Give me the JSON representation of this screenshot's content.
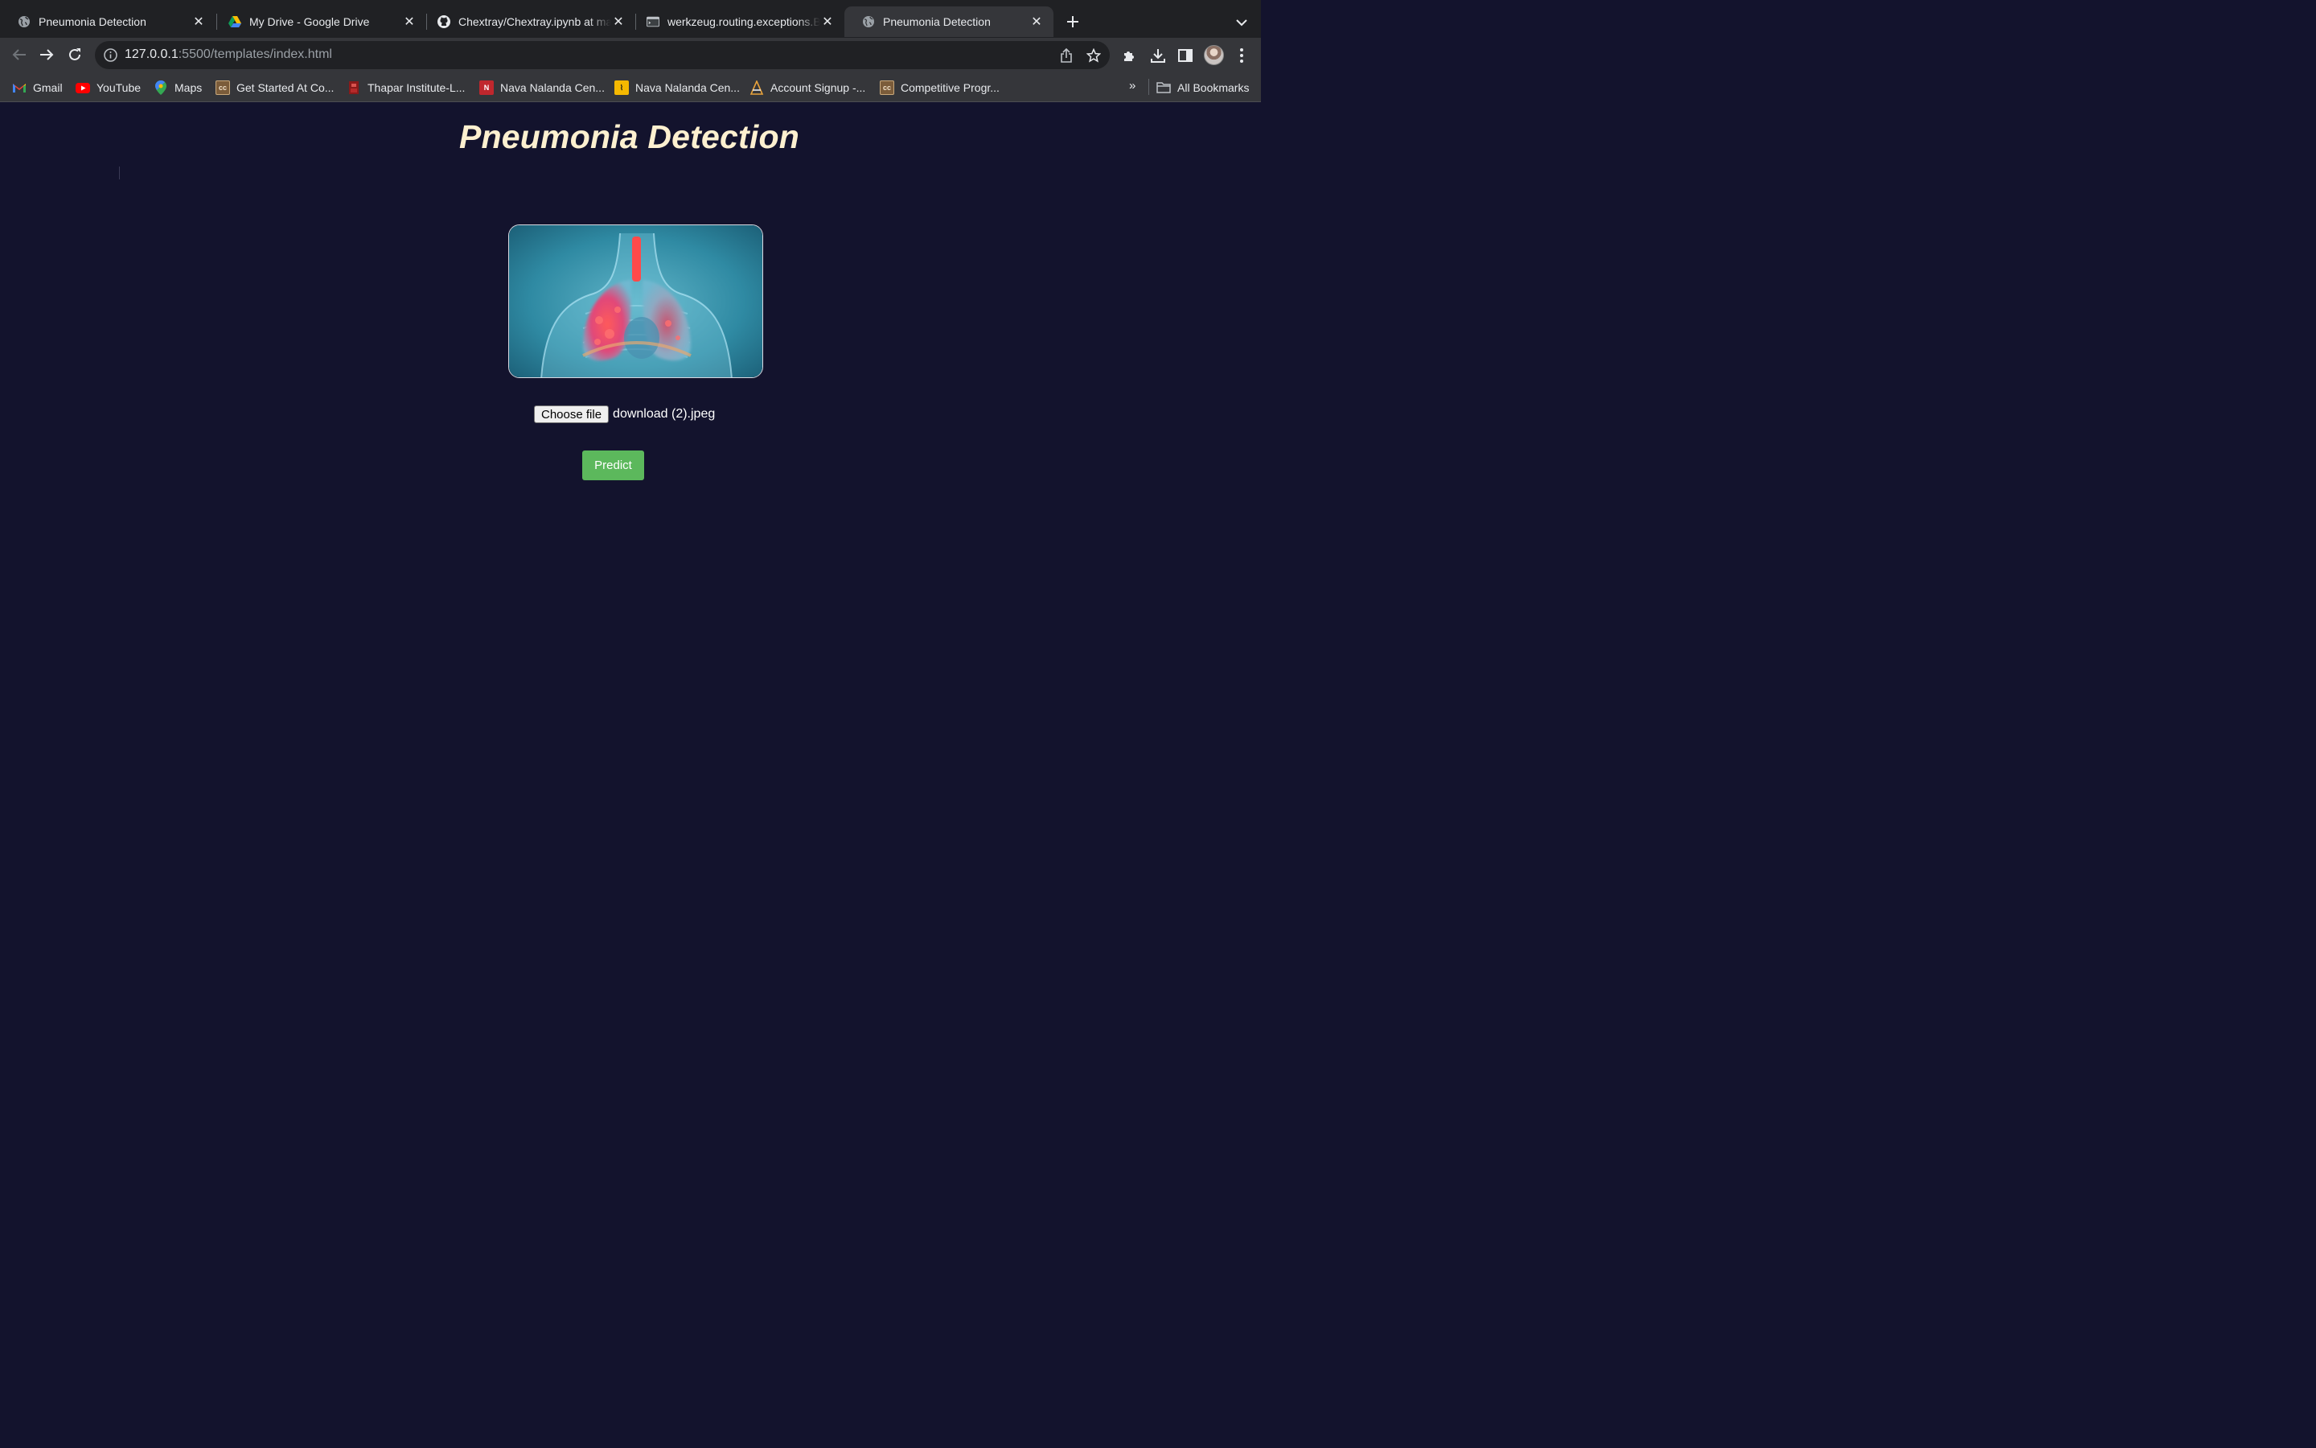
{
  "tabs": [
    {
      "title": "Pneumonia Detection",
      "favicon": "globe-icon",
      "active": false
    },
    {
      "title": "My Drive - Google Drive",
      "favicon": "google-drive-icon",
      "active": false
    },
    {
      "title": "Chextray/Chextray.ipynb at main",
      "favicon": "github-icon",
      "active": false
    },
    {
      "title": "werkzeug.routing.exceptions.BuildError",
      "favicon": "terminal-icon",
      "active": false
    },
    {
      "title": "Pneumonia Detection",
      "favicon": "globe-icon",
      "active": true
    }
  ],
  "address_bar": {
    "host": "127.0.0.1",
    "path": ":5500/templates/index.html"
  },
  "bookmarks": [
    {
      "label": "Gmail",
      "icon": "gmail-icon"
    },
    {
      "label": "YouTube",
      "icon": "youtube-icon"
    },
    {
      "label": "Maps",
      "icon": "maps-icon"
    },
    {
      "label": "Get Started At Co...",
      "icon": "codechef-icon"
    },
    {
      "label": "Thapar Institute-L...",
      "icon": "thapar-icon"
    },
    {
      "label": "Nava Nalanda Cen...",
      "icon": "nalanda-icon"
    },
    {
      "label": "Nava Nalanda Cen...",
      "icon": "nalanda-alt-icon"
    },
    {
      "label": "Account Signup -...",
      "icon": "account-icon"
    },
    {
      "label": "Competitive Progr...",
      "icon": "codechef-icon"
    }
  ],
  "bookmarks_overflow": "»",
  "all_bookmarks_label": "All Bookmarks",
  "page": {
    "title": "Pneumonia Detection",
    "hero_image": "lungs-xray-illustration",
    "choose_file_label": "Choose file",
    "selected_file": "download (2).jpeg",
    "predict_label": "Predict"
  },
  "colors": {
    "page_background": "#13132d",
    "title_color": "#fdf0d0",
    "predict_button": "#5cb85c",
    "browser_chrome": "#35363a",
    "tab_strip": "#202124"
  }
}
